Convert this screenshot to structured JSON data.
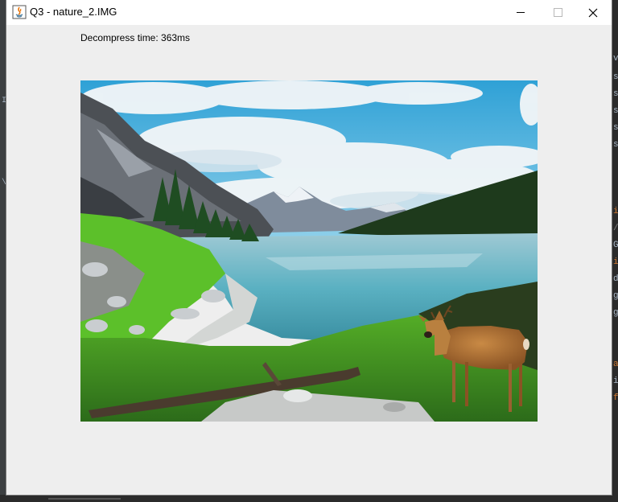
{
  "window": {
    "title": "Q3 - nature_2.IMG",
    "icon": "java-icon"
  },
  "content": {
    "decompress_label": "Decompress time: 363ms"
  },
  "image": {
    "subject": "mountain-lake-with-deer"
  },
  "background_editor": {
    "right_edge_chars": [
      "v",
      "s",
      "s",
      "s",
      "s",
      "s",
      "i",
      "/",
      "G",
      "i",
      "d",
      "g",
      "g",
      "a",
      "i",
      "f"
    ],
    "left_edge_chars": [
      "I",
      "\\"
    ]
  },
  "colors": {
    "window_bg": "#eeeeee",
    "titlebar_bg": "#ffffff",
    "ide_bg": "#2b2b2b"
  }
}
